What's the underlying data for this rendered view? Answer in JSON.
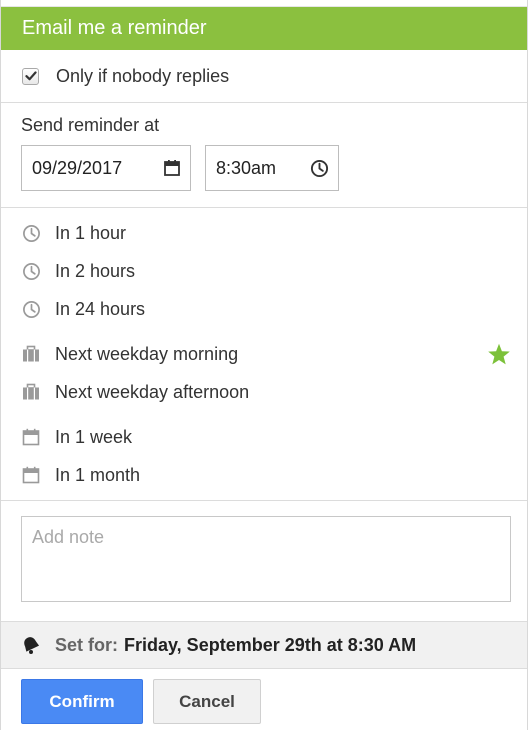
{
  "header": {
    "title": "Email me a reminder"
  },
  "condition": {
    "label": "Only if nobody replies",
    "checked": true
  },
  "send_at": {
    "label": "Send reminder at",
    "date_value": "09/29/2017",
    "time_value": "8:30am"
  },
  "options": [
    {
      "label": "In 1 hour",
      "icon": "clock-icon"
    },
    {
      "label": "In 2 hours",
      "icon": "clock-icon"
    },
    {
      "label": "In 24 hours",
      "icon": "clock-icon"
    },
    {
      "label": "Next weekday morning",
      "icon": "briefcase-icon",
      "starred": true
    },
    {
      "label": "Next weekday afternoon",
      "icon": "briefcase-icon"
    },
    {
      "label": "In 1 week",
      "icon": "calendar-icon"
    },
    {
      "label": "In 1 month",
      "icon": "calendar-icon"
    }
  ],
  "note": {
    "placeholder": "Add note",
    "value": ""
  },
  "summary": {
    "label": "Set for:",
    "value": "Friday, September 29th at 8:30 AM"
  },
  "buttons": {
    "confirm": "Confirm",
    "cancel": "Cancel"
  },
  "colors": {
    "header": "#8bc03f",
    "confirm": "#4a8af4",
    "star": "#7cc13a"
  }
}
